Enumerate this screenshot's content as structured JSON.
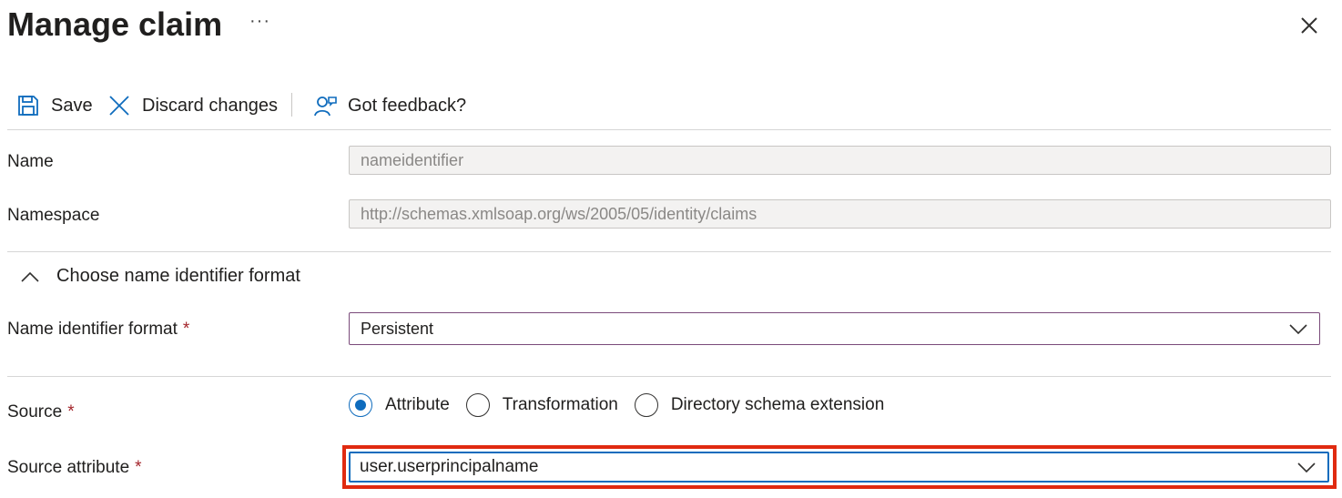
{
  "header": {
    "title": "Manage claim",
    "more_label": "···"
  },
  "toolbar": {
    "save_label": "Save",
    "discard_label": "Discard changes",
    "feedback_label": "Got feedback?"
  },
  "form": {
    "name": {
      "label": "Name",
      "value": "nameidentifier"
    },
    "namespace": {
      "label": "Namespace",
      "value": "http://schemas.xmlsoap.org/ws/2005/05/identity/claims"
    },
    "section": {
      "label": "Choose name identifier format"
    },
    "name_id_format": {
      "label": "Name identifier format",
      "required": "*",
      "value": "Persistent"
    },
    "source": {
      "label": "Source",
      "required": "*",
      "options": [
        "Attribute",
        "Transformation",
        "Directory schema extension"
      ],
      "selected": "Attribute"
    },
    "source_attribute": {
      "label": "Source attribute",
      "required": "*",
      "value": "user.userprincipalname"
    }
  },
  "colors": {
    "accent": "#0f6cbd",
    "highlight": "#e02a10",
    "required": "#a4262c"
  }
}
